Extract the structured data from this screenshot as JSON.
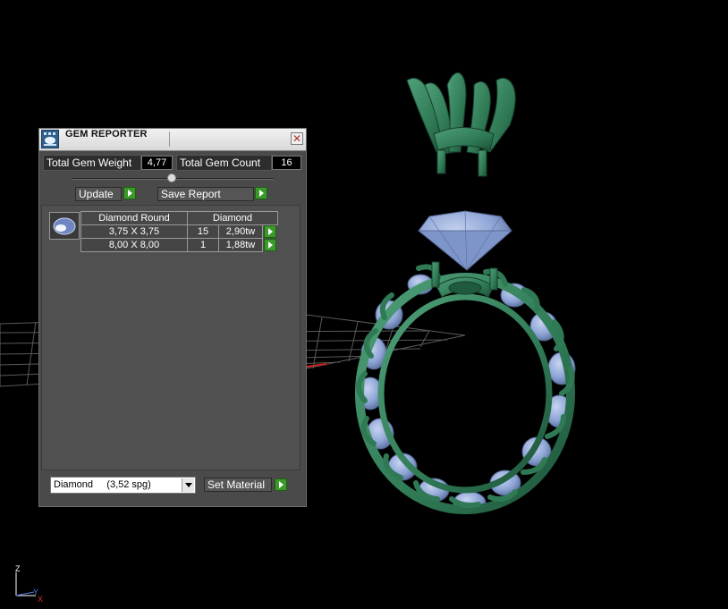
{
  "panel": {
    "title": "GEM REPORTER",
    "close_label": "✕",
    "total_weight_label": "Total Gem Weight",
    "total_weight_value": "4,77",
    "total_count_label": "Total Gem Count",
    "total_count_value": "16",
    "update_label": "Update",
    "save_label": "Save Report",
    "table": {
      "headers": [
        "Diamond Round",
        "Diamond"
      ],
      "rows": [
        {
          "size": "3,75 X 3,75",
          "count": "15",
          "weight": "2,90tw"
        },
        {
          "size": "8,00 X 8,00",
          "count": "1",
          "weight": "1,88tw"
        }
      ]
    },
    "material_selected": "Diamond     (3,52 spg)",
    "set_material_label": "Set Material"
  },
  "axis": {
    "z": "Z",
    "y": "Y",
    "x": "X"
  },
  "colors": {
    "metal": "#2f7a55",
    "gem": "#8ea5d6",
    "play_button": "#3c9a2a",
    "panel_bg": "#4a4a4a"
  },
  "icons": [
    "gem-reporter-app-icon",
    "close-icon",
    "play-icon",
    "slider-knob-icon",
    "dropdown-arrow-icon",
    "gem-thumbnail-icon"
  ]
}
